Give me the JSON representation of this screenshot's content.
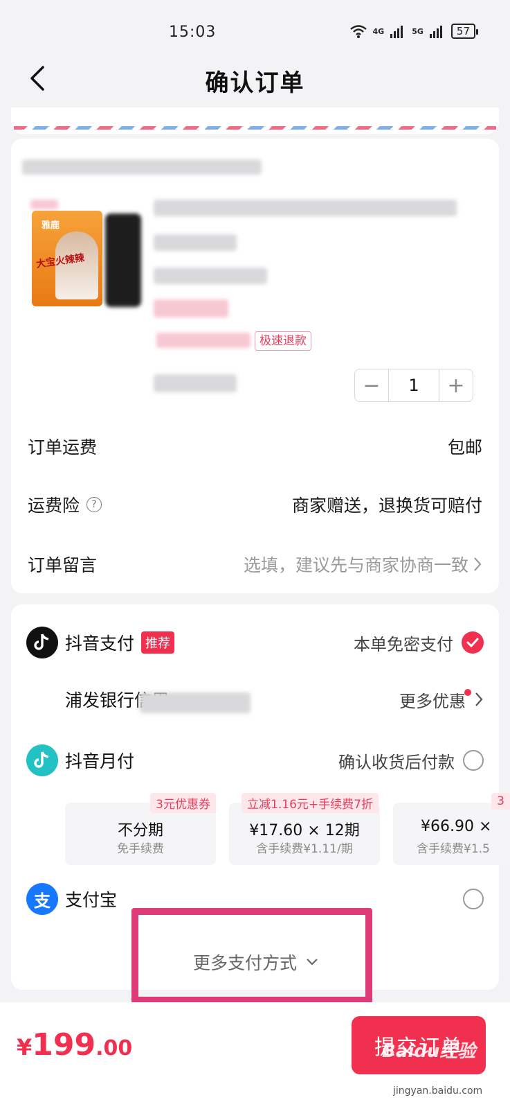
{
  "status_bar": {
    "time": "15:03",
    "net1": "4G",
    "net2": "5G",
    "battery": "57"
  },
  "nav": {
    "title": "确认订单"
  },
  "product": {
    "brand_on_package": "雅鹿",
    "package_text": "大宝火辣辣",
    "refund_tag": "极速退款",
    "quantity": "1",
    "minus": "−",
    "plus": "+"
  },
  "order_rows": {
    "shipping_label": "订单运费",
    "shipping_value": "包邮",
    "insurance_label": "运费险",
    "insurance_value": "商家赠送，退换货可赔付",
    "message_label": "订单留言",
    "message_placeholder": "选填，建议先与商家协商一致"
  },
  "payment": {
    "douyin_pay_label": "抖音支付",
    "recommend_badge": "推荐",
    "douyin_pay_right": "本单免密支付",
    "bank_label": "浦发银行信用",
    "bank_more": "更多优惠",
    "monthly_label": "抖音月付",
    "monthly_right": "确认收货后付款",
    "plans": [
      {
        "tag": "3元优惠券",
        "main": "不分期",
        "sub": "免手续费"
      },
      {
        "tag": "立减1.16元+手续费7折",
        "main": "¥17.60 × 12期",
        "sub": "含手续费¥1.11/期"
      },
      {
        "tag": "3",
        "main": "¥66.90 ×",
        "sub": "含手续费¥1.5"
      }
    ],
    "alipay_label": "支付宝",
    "alipay_logo": "支",
    "more_methods": "更多支付方式"
  },
  "bottom": {
    "currency": "¥",
    "total_int": "199",
    "total_dec": ".00",
    "submit": "提交订单",
    "watermark": "Baidu经验",
    "watermark_url": "jingyan.baidu.com"
  },
  "colors": {
    "accent": "#f0304e",
    "highlight": "#dc3b78",
    "alipay": "#1677ff",
    "monthly": "#22c1c3"
  }
}
